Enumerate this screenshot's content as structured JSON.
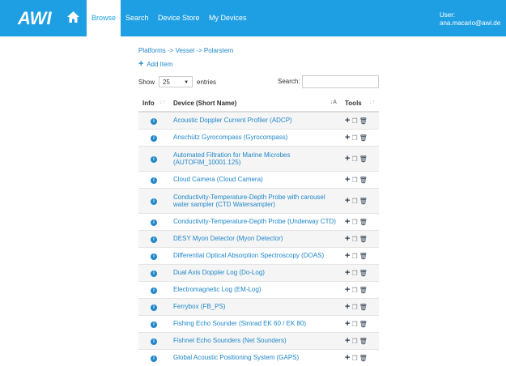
{
  "nav": {
    "logo_text": "AWI",
    "tabs": [
      "Browse",
      "Search",
      "Device Store",
      "My Devices"
    ],
    "user_label": "User:",
    "user_email": "ana.macario@awi.de"
  },
  "breadcrumb": "Platforms -> Vessel -> Polarstern",
  "add_item": "Add Item",
  "show_label": "Show",
  "entries_value": "25",
  "entries_label": "entries",
  "search_label": "Search:",
  "table": {
    "headers": [
      "Info",
      "Device (Short Name)",
      "Tools"
    ],
    "rows": [
      "Acoustic Doppler Current Profiler (ADCP)",
      "Anschütz Gyrocompass (Gyrocompass)",
      "Automated Filtration for Marine Microbes (AUTOFIM_10001.125)",
      "Cloud Camera (Cloud Camera)",
      "Conductivity-Temperature-Depth Probe with carousel water sampler (CTD Watersampler)",
      "Conductivity-Temperature-Depth Probe (Underway CTD)",
      "DESY Myon Detector (Myon Detector)",
      "Differential Optical Absorption Spectroscopy (DOAS)",
      "Dual Axis Doppler Log (Do-Log)",
      "Electromagnetic Log (EM-Log)",
      "Ferrybox (FB_PS)",
      "Fishing Echo Sounder (Simrad EK 60 / EK 80)",
      "Fishnet Echo Sounders (Net Sounders)",
      "Global Acoustic Positioning System (GAPS)"
    ]
  },
  "colors": {
    "primary": "#1e9fe3",
    "link": "#1f87c9"
  }
}
